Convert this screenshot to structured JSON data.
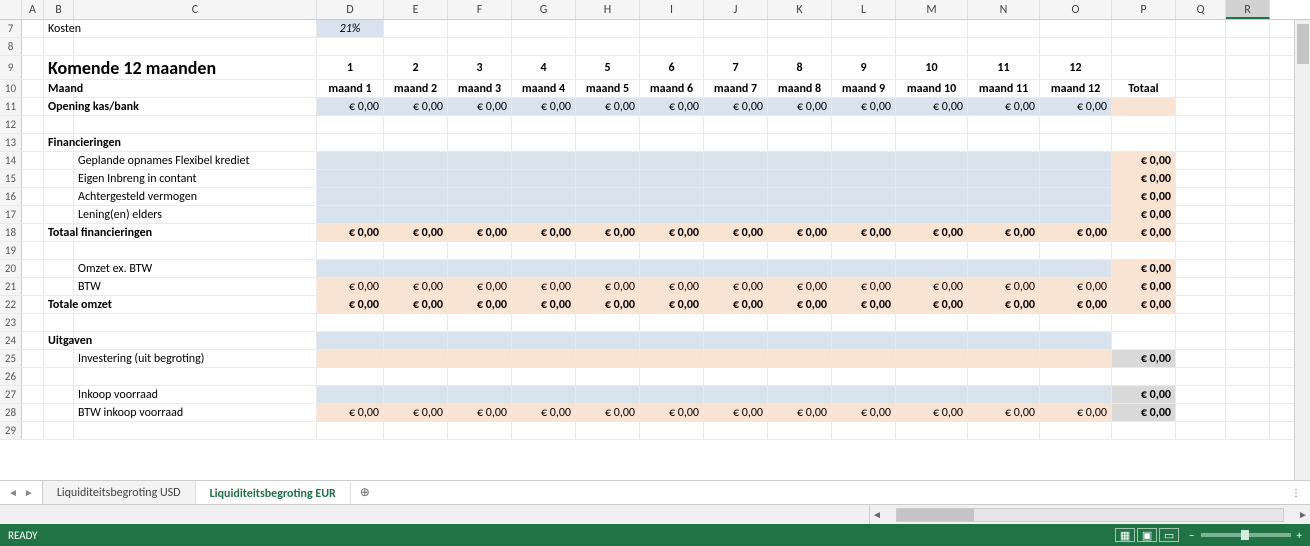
{
  "columns": [
    "",
    "A",
    "B",
    "C",
    "D",
    "E",
    "F",
    "G",
    "H",
    "I",
    "J",
    "K",
    "L",
    "M",
    "N",
    "O",
    "P",
    "Q",
    "R"
  ],
  "row_nums": [
    "7",
    "8",
    "9",
    "10",
    "11",
    "12",
    "13",
    "14",
    "15",
    "16",
    "17",
    "18",
    "19",
    "20",
    "21",
    "22",
    "23",
    "24",
    "25",
    "26",
    "27",
    "28",
    "29"
  ],
  "r7": {
    "kosten": "Kosten",
    "pct": "21%"
  },
  "r9": {
    "title": "Komende 12 maanden",
    "nums": [
      "1",
      "2",
      "3",
      "4",
      "5",
      "6",
      "7",
      "8",
      "9",
      "10",
      "11",
      "12"
    ]
  },
  "r10": {
    "label": "Maand",
    "months": [
      "maand 1",
      "maand 2",
      "maand 3",
      "maand 4",
      "maand 5",
      "maand 6",
      "maand 7",
      "maand 8",
      "maand 9",
      "maand 10",
      "maand 11",
      "maand 12"
    ],
    "total": "Totaal"
  },
  "r11": {
    "label": "Opening kas/bank",
    "vals": [
      "€ 0,00",
      "€ 0,00",
      "€ 0,00",
      "€ 0,00",
      "€ 0,00",
      "€ 0,00",
      "€ 0,00",
      "€ 0,00",
      "€ 0,00",
      "€ 0,00",
      "€ 0,00",
      "€ 0,00"
    ]
  },
  "r13": {
    "label": "Financieringen"
  },
  "r14": {
    "label": "Geplande opnames Flexibel krediet",
    "total": "€ 0,00"
  },
  "r15": {
    "label": "Eigen Inbreng in contant",
    "total": "€ 0,00"
  },
  "r16": {
    "label": "Achtergesteld vermogen",
    "total": "€ 0,00"
  },
  "r17": {
    "label": "Lening(en) elders",
    "total": "€ 0,00"
  },
  "r18": {
    "label": "Totaal financieringen",
    "vals": [
      "€ 0,00",
      "€ 0,00",
      "€ 0,00",
      "€ 0,00",
      "€ 0,00",
      "€ 0,00",
      "€ 0,00",
      "€ 0,00",
      "€ 0,00",
      "€ 0,00",
      "€ 0,00",
      "€ 0,00"
    ],
    "total": "€ 0,00"
  },
  "r20": {
    "label": "Omzet ex. BTW",
    "total": "€ 0,00"
  },
  "r21": {
    "label": "BTW",
    "vals": [
      "€ 0,00",
      "€ 0,00",
      "€ 0,00",
      "€ 0,00",
      "€ 0,00",
      "€ 0,00",
      "€ 0,00",
      "€ 0,00",
      "€ 0,00",
      "€ 0,00",
      "€ 0,00",
      "€ 0,00"
    ],
    "total": "€ 0,00"
  },
  "r22": {
    "label": "Totale omzet",
    "vals": [
      "€ 0,00",
      "€ 0,00",
      "€ 0,00",
      "€ 0,00",
      "€ 0,00",
      "€ 0,00",
      "€ 0,00",
      "€ 0,00",
      "€ 0,00",
      "€ 0,00",
      "€ 0,00",
      "€ 0,00"
    ],
    "total": "€ 0,00"
  },
  "r24": {
    "label": "Uitgaven"
  },
  "r25": {
    "label": "Investering (uit begroting)",
    "total": "€ 0,00"
  },
  "r27": {
    "label": "Inkoop voorraad",
    "total": "€ 0,00"
  },
  "r28": {
    "label": "BTW inkoop voorraad",
    "vals": [
      "€ 0,00",
      "€ 0,00",
      "€ 0,00",
      "€ 0,00",
      "€ 0,00",
      "€ 0,00",
      "€ 0,00",
      "€ 0,00",
      "€ 0,00",
      "€ 0,00",
      "€ 0,00",
      "€ 0,00"
    ],
    "total": "€ 0,00"
  },
  "tabs": {
    "prev": "◄",
    "next": "►",
    "t1": "Liquiditeitsbegroting USD",
    "t2": "Liquiditeitsbegroting EUR",
    "add": "⊕"
  },
  "status": {
    "ready": "READY",
    "zoom": "– ——●—— +"
  }
}
